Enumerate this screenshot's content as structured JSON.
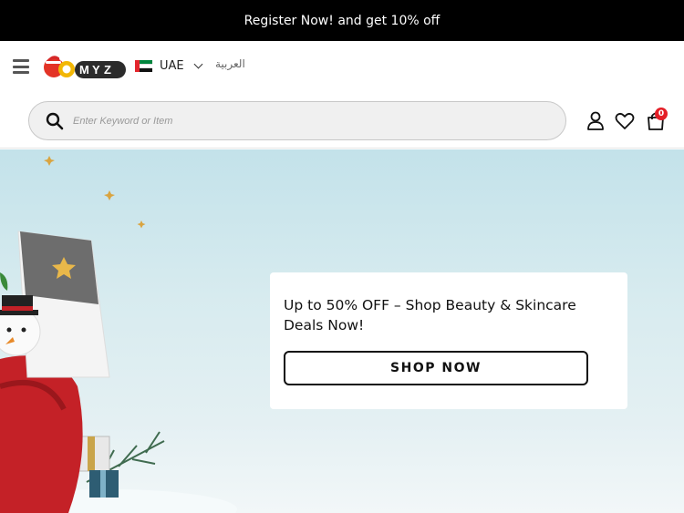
{
  "promo": {
    "text": "Register Now! and get 10% off"
  },
  "header": {
    "logo_text": "GOMYZ",
    "country": {
      "code": "UAE",
      "flag": "uae-flag-icon"
    },
    "language": "العربية",
    "search": {
      "placeholder": "Enter Keyword or Item",
      "value": ""
    },
    "cart": {
      "count": "0"
    },
    "icons": [
      "menu-icon",
      "search-icon",
      "user-icon",
      "heart-icon",
      "bag-icon"
    ]
  },
  "hero": {
    "headline": "Up to 50% OFF – Shop Beauty & Skincare Deals Now!",
    "cta_label": "SHOP NOW"
  },
  "colors": {
    "promo_bg": "#000000",
    "badge": "#e41e26",
    "hero_sky": "#c3e2ea"
  }
}
